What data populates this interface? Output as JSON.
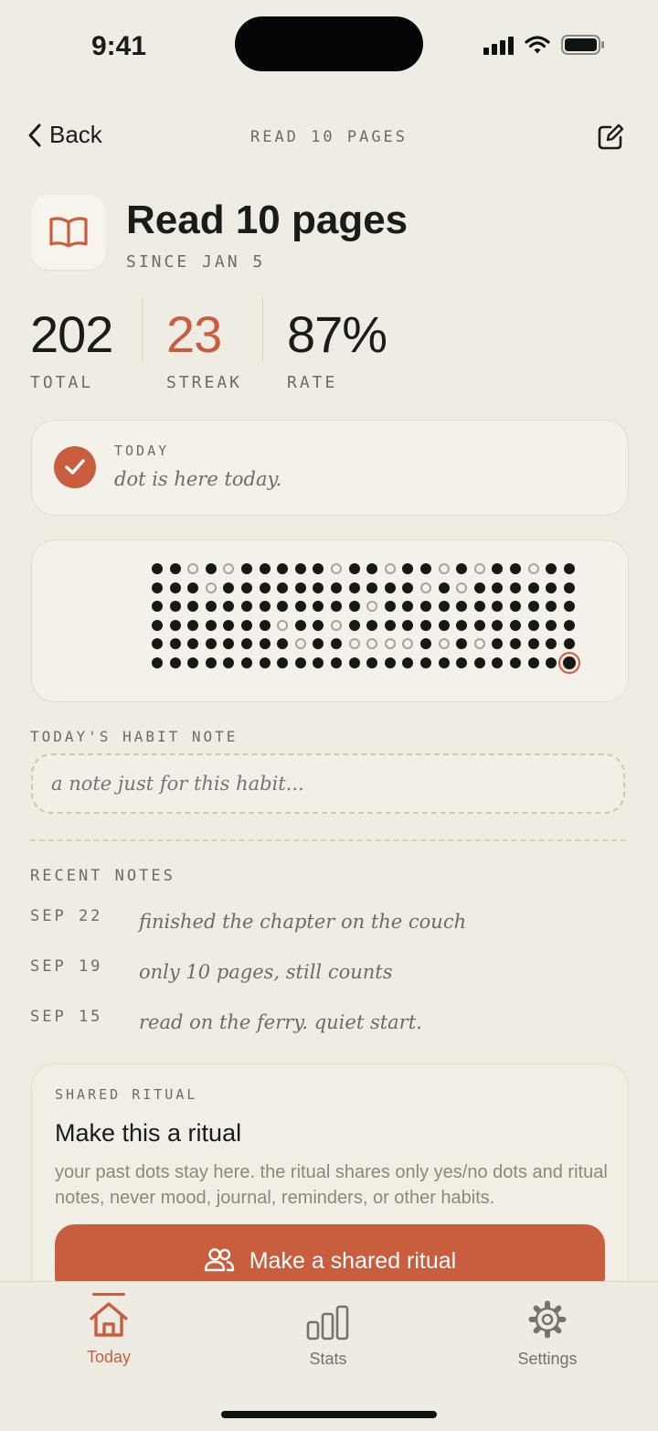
{
  "status_bar": {
    "time": "9:41"
  },
  "nav": {
    "back_label": "Back",
    "title": "READ 10 PAGES"
  },
  "habit": {
    "title": "Read 10 pages",
    "since": "SINCE JAN 5",
    "icon": "book-icon"
  },
  "stats": [
    {
      "value": "202",
      "label": "TOTAL"
    },
    {
      "value": "23",
      "label": "STREAK",
      "color": "#c95e3f"
    },
    {
      "value": "87%",
      "label": "RATE"
    }
  ],
  "today": {
    "label": "TODAY",
    "note": "dot is here today.",
    "done": true
  },
  "dot_grid": {
    "rows": [
      "110101111101101101011011",
      "111011111111111010111111",
      "111111111111011111111111",
      "111111101101111111111111",
      "111111110110000101011111",
      "111111111111111111111112"
    ]
  },
  "habit_note": {
    "label": "TODAY'S HABIT NOTE",
    "placeholder": "a note just for this habit..."
  },
  "recent_notes": {
    "label": "RECENT NOTES",
    "items": [
      {
        "date": "SEP 22",
        "text": "finished the chapter on the couch"
      },
      {
        "date": "SEP 19",
        "text": "only 10 pages, still counts"
      },
      {
        "date": "SEP 15",
        "text": "read on the ferry. quiet start."
      }
    ]
  },
  "ritual": {
    "label": "SHARED RITUAL",
    "title": "Make this a ritual",
    "description": "your past dots stay here. the ritual shares only yes/no dots and ritual notes, never mood, journal, reminders, or other habits.",
    "button_label": "Make a shared ritual"
  },
  "tabs": [
    {
      "label": "Today",
      "icon": "home-icon",
      "active": true
    },
    {
      "label": "Stats",
      "icon": "bar-chart-icon",
      "active": false
    },
    {
      "label": "Settings",
      "icon": "gear-icon",
      "active": false
    }
  ],
  "colors": {
    "accent": "#c95e3f",
    "background": "#efece4",
    "ink": "#1d1b19"
  }
}
